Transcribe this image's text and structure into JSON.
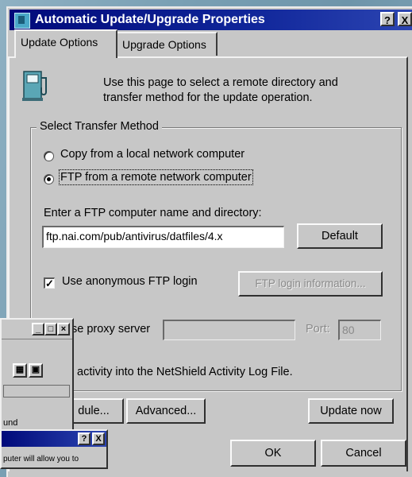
{
  "dialog": {
    "title": "Automatic Update/Upgrade Properties",
    "help_button": "?",
    "close_button": "X"
  },
  "tabs": [
    {
      "label": "Update Options",
      "active": true
    },
    {
      "label": "Upgrade Options",
      "active": false
    }
  ],
  "intro_text": "Use this page to select a remote directory and transfer method for the update operation.",
  "transfer": {
    "group_label": "Select Transfer Method",
    "options": [
      {
        "label": "Copy from a local network computer",
        "selected": false
      },
      {
        "label": "FTP from a remote network computer",
        "selected": true
      }
    ]
  },
  "ftp": {
    "label": "Enter a FTP computer name and directory:",
    "value": "ftp.nai.com/pub/antivirus/datfiles/4.x",
    "default_button": "Default",
    "anonymous_label": "Use anonymous FTP login",
    "anonymous_checked": true,
    "login_info_button": "FTP login information..."
  },
  "proxy": {
    "label": "se proxy server",
    "port_label": "Port:",
    "port_value": "80"
  },
  "log_text": "activity into the NetShield Activity Log File.",
  "bottom_buttons": {
    "schedule": "dule...",
    "advanced": "Advanced...",
    "update_now": "Update now"
  },
  "footer_buttons": {
    "ok": "OK",
    "cancel": "Cancel"
  },
  "overlap_window": {
    "fragment_text": "und",
    "help_button": "?",
    "close_button": "X",
    "fragment_text_2": "puter will allow you to"
  },
  "colors": {
    "title_gradient_start": "#000a7a",
    "title_gradient_end": "#2c45b2",
    "face": "#c7c7c7"
  }
}
